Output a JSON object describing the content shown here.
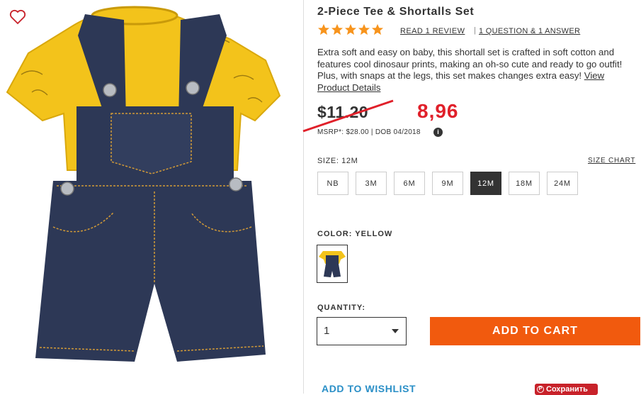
{
  "product": {
    "title": "2-Piece Tee & Shortalls Set",
    "rating_stars": 5,
    "review_link": "READ 1 REVIEW",
    "qa_link": "1 QUESTION & 1 ANSWER",
    "description": "Extra soft and easy on baby, this shortall set is crafted in soft cotton and features cool dinosaur prints, making an oh-so cute and ready to go outfit! Plus, with snaps at the legs, this set makes changes extra easy!",
    "details_link": "View Product Details",
    "old_price": "$11.20",
    "new_price": "8,96",
    "msrp": "MSRP*: $28.00 | DOB 04/2018",
    "info_icon": "i"
  },
  "size": {
    "label": "SIZE: 12M",
    "chart_link": "SIZE CHART",
    "options": [
      "NB",
      "3M",
      "6M",
      "9M",
      "12M",
      "18M",
      "24M"
    ],
    "selected": "12M"
  },
  "color": {
    "label": "COLOR: YELLOW"
  },
  "quantity": {
    "label": "QUANTITY:",
    "value": "1"
  },
  "actions": {
    "add_to_cart": "ADD TO CART",
    "wishlist": "ADD TO WISHLIST",
    "pinterest": "Сохранить",
    "pinterest_icon": "P"
  },
  "colors": {
    "accent_orange": "#f15a0e",
    "price_red": "#e0202a",
    "link_blue": "#2a8fc7",
    "denim": "#2b3552",
    "tee_yellow": "#f5c518"
  }
}
